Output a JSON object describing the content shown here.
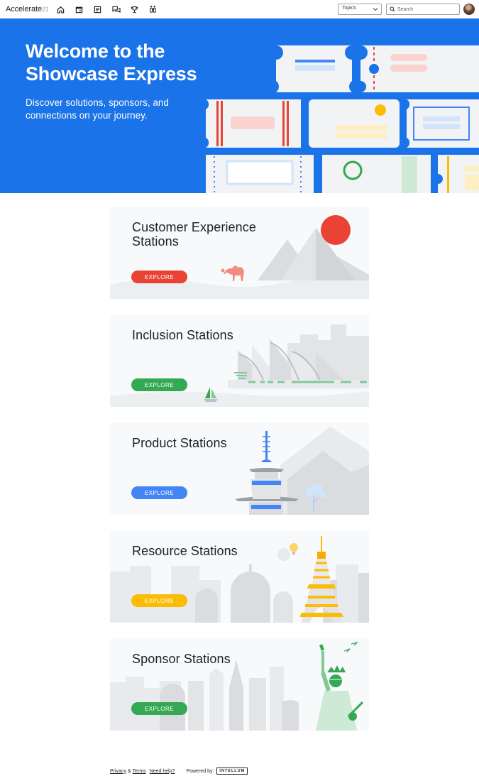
{
  "nav": {
    "brand": "Accelerate",
    "brand_suffix": "21",
    "icons": [
      "home-icon",
      "calendar-icon",
      "article-icon",
      "forum-icon",
      "trophy-icon",
      "team-icon"
    ],
    "topics_label": "Topics",
    "search_placeholder": "Search"
  },
  "hero": {
    "title": "Welcome to the Showcase Express",
    "subtitle": "Discover solutions, sponsors, and connections on your journey."
  },
  "cards": [
    {
      "title": "Customer Experience Stations",
      "button": "EXPLORE",
      "color": "#ea4335"
    },
    {
      "title": "Inclusion Stations",
      "button": "EXPLORE",
      "color": "#34a853"
    },
    {
      "title": "Product Stations",
      "button": "EXPLORE",
      "color": "#4285f4"
    },
    {
      "title": "Resource Stations",
      "button": "EXPLORE",
      "color": "#fbbc04"
    },
    {
      "title": "Sponsor Stations",
      "button": "EXPLORE",
      "color": "#34a853"
    }
  ],
  "footer": {
    "privacy": "Privacy",
    "amp": "&",
    "terms": "Terms",
    "help": "Need help?",
    "powered": "Powered by:",
    "vendor": "INTELLUM"
  },
  "colors": {
    "primary_blue": "#1a73e8",
    "red": "#ea4335",
    "green": "#34a853",
    "blue": "#4285f4",
    "yellow": "#fbbc04"
  }
}
